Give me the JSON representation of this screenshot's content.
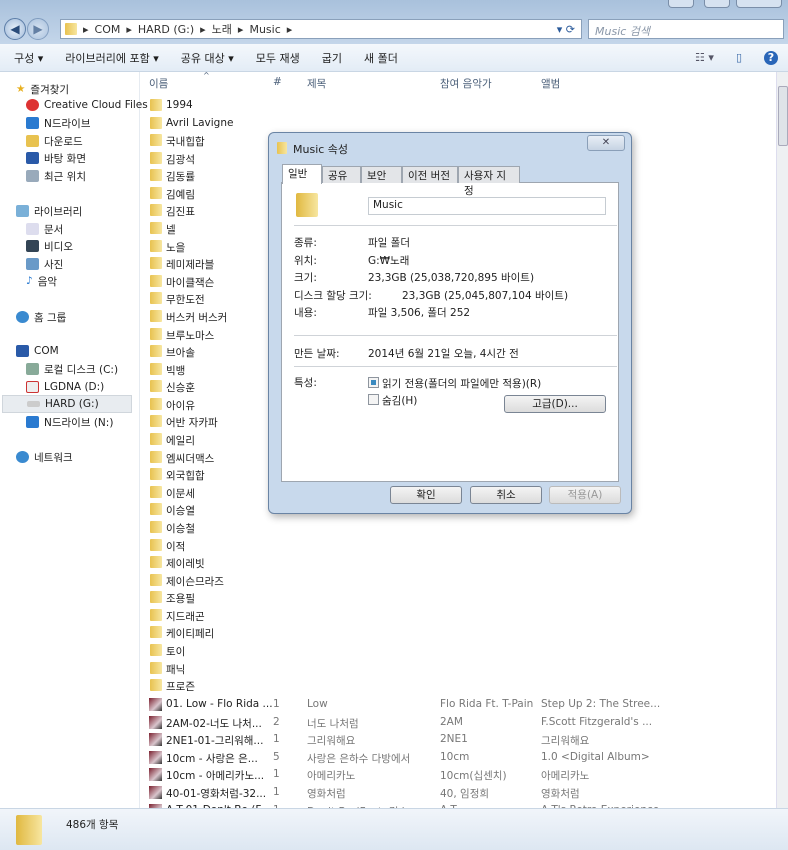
{
  "window": {
    "address": [
      "COM",
      "HARD (G:)",
      "노래",
      "Music"
    ],
    "search_placeholder": "Music 검색"
  },
  "toolbar": [
    "구성 ▾",
    "라이브러리에 포함 ▾",
    "공유 대상 ▾",
    "모두 재생",
    "굽기",
    "새 폴더"
  ],
  "sidebar": {
    "favorites": "즐겨찾기",
    "fav_items": [
      "Creative Cloud Files",
      "N드라이브",
      "다운로드",
      "바탕 화면",
      "최근 위치"
    ],
    "libraries": "라이브러리",
    "lib_items": [
      "문서",
      "비디오",
      "사진",
      "음악"
    ],
    "homegroup": "홈 그룹",
    "computer": "COM",
    "drives": [
      "로컬 디스크 (C:)",
      "LGDNA (D:)",
      "HARD (G:)",
      "N드라이브 (N:)"
    ],
    "network": "네트워크",
    "selected": "HARD (G:)"
  },
  "columns": [
    "이름",
    "#",
    "제목",
    "참여 음악가",
    "앨범"
  ],
  "folders": [
    "1994",
    "Avril Lavigne",
    "국내힙합",
    "김광석",
    "김동률",
    "김예림",
    "김진표",
    "넬",
    "노을",
    "레미제라블",
    "마이클잭슨",
    "무한도전",
    "버스커 버스커",
    "브루노마스",
    "브아솔",
    "빅뱅",
    "신승훈",
    "아이유",
    "어반 자카파",
    "에일리",
    "엠씨더맥스",
    "외국힙합",
    "이문세",
    "이승열",
    "이승철",
    "이적",
    "제이레빗",
    "제이슨므라즈",
    "조용필",
    "지드래곤",
    "케이티페리",
    "토이",
    "패닉",
    "프로즌"
  ],
  "files": [
    {
      "name": "01. Low - Flo Rida ...",
      "num": "1",
      "title": "Low",
      "artist": "Flo Rida Ft. T-Pain",
      "album": "Step Up 2: The Stree..."
    },
    {
      "name": "2AM-02-너도 나처...",
      "num": "2",
      "title": "너도 나처럼",
      "artist": "2AM",
      "album": "F.Scott Fitzgerald's ..."
    },
    {
      "name": "2NE1-01-그리워해...",
      "num": "1",
      "title": "그리워해요",
      "artist": "2NE1",
      "album": "그리워해요"
    },
    {
      "name": "10cm - 사랑은 은...",
      "num": "5",
      "title": "사랑은 은하수 다방에서",
      "artist": "10cm",
      "album": "1.0 <Digital Album>"
    },
    {
      "name": "10cm - 아메리카노...",
      "num": "1",
      "title": "아메리카노",
      "artist": "10cm(십센치)",
      "album": "아메리카노"
    },
    {
      "name": "40-01-영화처럼-32...",
      "num": "1",
      "title": "영화처럼",
      "artist": "40, 임정희",
      "album": "영화처럼"
    },
    {
      "name": "A.T-01-Don't Be (F...",
      "num": "1",
      "title": "Don't Be (Feat. 김소...",
      "artist": "A.T",
      "album": "A.T's Retro Experience"
    }
  ],
  "status": "486개 항목",
  "dialog": {
    "title": "Music 속성",
    "close": "✕",
    "tabs": [
      "일반",
      "공유",
      "보안",
      "이전 버전",
      "사용자 지정"
    ],
    "name": "Music",
    "props": [
      {
        "label": "종류:",
        "value": "파일 폴더"
      },
      {
        "label": "위치:",
        "value": "G:₩노래"
      },
      {
        "label": "크기:",
        "value": "23,3GB (25,038,720,895 바이트)"
      },
      {
        "label": "디스크 할당 크기:",
        "value": "23,3GB (25,045,807,104 바이트)"
      },
      {
        "label": "내용:",
        "value": "파일 3,506, 폴더 252"
      }
    ],
    "created_label": "만든 날짜:",
    "created": "2014년 6월 21일 오늘, 4시간 전",
    "attr_label": "특성:",
    "readonly": "읽기 전용(폴더의 파일에만 적용)(R)",
    "hidden": "숨김(H)",
    "advanced": "고급(D)...",
    "ok": "확인",
    "cancel": "취소",
    "apply": "적용(A)"
  }
}
